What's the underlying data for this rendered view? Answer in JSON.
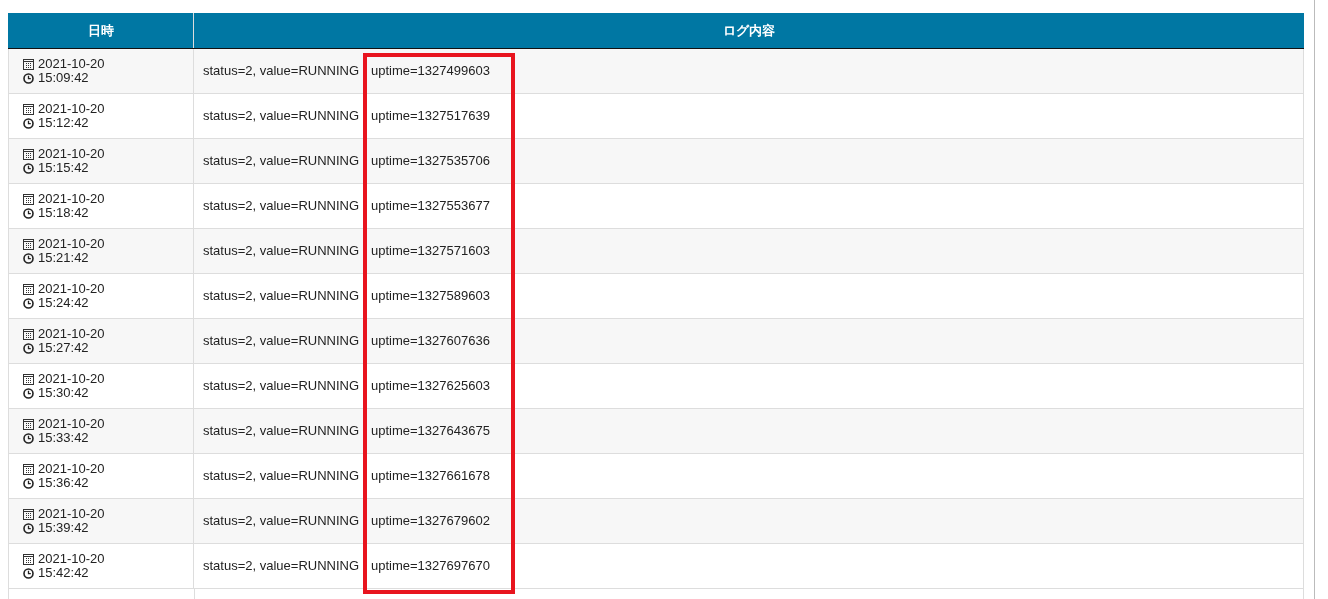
{
  "table": {
    "columns": [
      "日時",
      "ログ内容"
    ],
    "rows": [
      {
        "date": "2021-10-20",
        "time": "15:09:42",
        "log": [
          "status=2, value=RUNNING",
          "uptime=1327499603"
        ]
      },
      {
        "date": "2021-10-20",
        "time": "15:12:42",
        "log": [
          "status=2, value=RUNNING",
          "uptime=1327517639"
        ]
      },
      {
        "date": "2021-10-20",
        "time": "15:15:42",
        "log": [
          "status=2, value=RUNNING",
          "uptime=1327535706"
        ]
      },
      {
        "date": "2021-10-20",
        "time": "15:18:42",
        "log": [
          "status=2, value=RUNNING",
          "uptime=1327553677"
        ]
      },
      {
        "date": "2021-10-20",
        "time": "15:21:42",
        "log": [
          "status=2, value=RUNNING",
          "uptime=1327571603"
        ]
      },
      {
        "date": "2021-10-20",
        "time": "15:24:42",
        "log": [
          "status=2, value=RUNNING",
          "uptime=1327589603"
        ]
      },
      {
        "date": "2021-10-20",
        "time": "15:27:42",
        "log": [
          "status=2, value=RUNNING",
          "uptime=1327607636"
        ]
      },
      {
        "date": "2021-10-20",
        "time": "15:30:42",
        "log": [
          "status=2, value=RUNNING",
          "uptime=1327625603"
        ]
      },
      {
        "date": "2021-10-20",
        "time": "15:33:42",
        "log": [
          "status=2, value=RUNNING",
          "uptime=1327643675"
        ]
      },
      {
        "date": "2021-10-20",
        "time": "15:36:42",
        "log": [
          "status=2, value=RUNNING",
          "uptime=1327661678"
        ]
      },
      {
        "date": "2021-10-20",
        "time": "15:39:42",
        "log": [
          "status=2, value=RUNNING",
          "uptime=1327679602"
        ]
      },
      {
        "date": "2021-10-20",
        "time": "15:42:42",
        "log": [
          "status=2, value=RUNNING",
          "uptime=1327697670"
        ]
      }
    ]
  }
}
